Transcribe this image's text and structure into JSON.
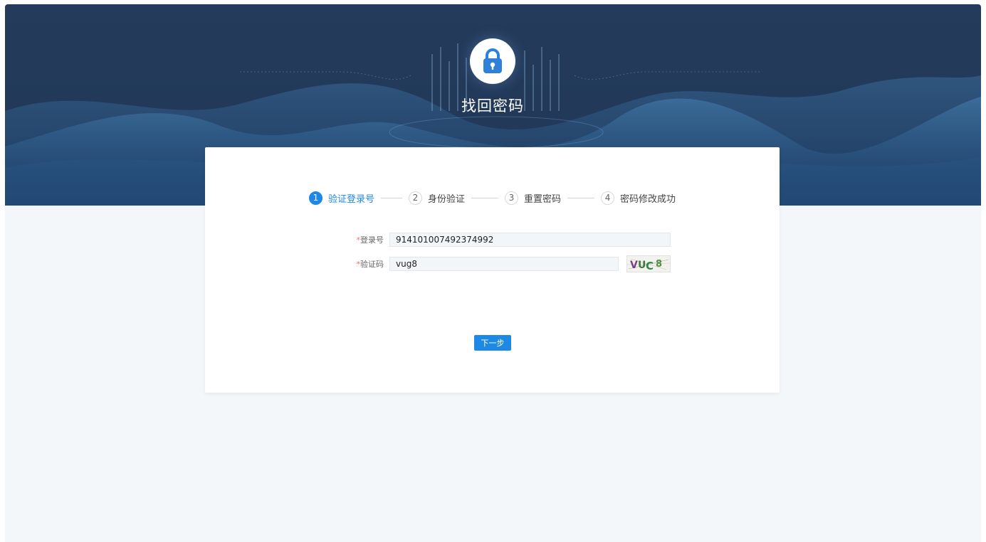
{
  "header": {
    "title": "找回密码",
    "icon": "lock-icon"
  },
  "steps": [
    {
      "num": "1",
      "label": "验证登录号"
    },
    {
      "num": "2",
      "label": "身份验证"
    },
    {
      "num": "3",
      "label": "重置密码"
    },
    {
      "num": "4",
      "label": "密码修改成功"
    }
  ],
  "form": {
    "required_mark": "*",
    "login_label": "登录号",
    "login_value": "914101007492374992",
    "captcha_label": "验证码",
    "captcha_value": "vug8",
    "captcha_image_text": "VUC8"
  },
  "actions": {
    "next_label": "下一步"
  },
  "colors": {
    "accent": "#1e88e5",
    "banner": "#243b5b",
    "page_bg": "#f4f7fa"
  }
}
